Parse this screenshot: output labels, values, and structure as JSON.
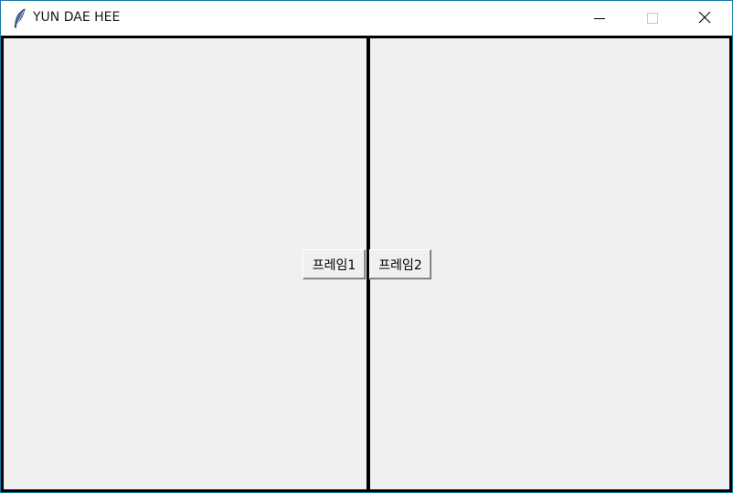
{
  "window": {
    "title": "YUN DAE HEE",
    "app_icon": "feather-icon",
    "controls": {
      "minimize_icon": "minimize-icon",
      "maximize_icon": "maximize-icon",
      "close_icon": "close-icon"
    }
  },
  "frames": [
    {
      "name": "frame1",
      "button_label": "프레임1"
    },
    {
      "name": "frame2",
      "button_label": "프레임2"
    }
  ],
  "colors": {
    "window_border": "#1a7aa8",
    "frame_background": "#f0f0f0",
    "frame_border": "#000000"
  }
}
